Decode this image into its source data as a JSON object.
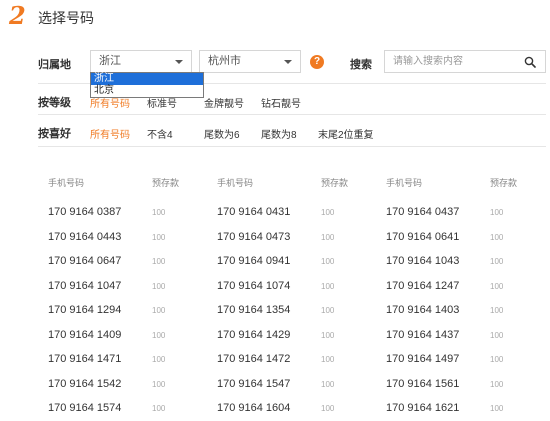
{
  "header": {
    "step": "2",
    "title": "选择号码"
  },
  "location": {
    "label": "归属地",
    "province": "浙江",
    "city": "杭州市",
    "options": [
      "浙江",
      "北京"
    ],
    "help": "?"
  },
  "search": {
    "label": "搜索",
    "placeholder": "请输入搜索内容"
  },
  "grade": {
    "label": "按等级",
    "items": [
      "所有号码",
      "标准号",
      "金牌靓号",
      "钻石靓号"
    ]
  },
  "preference": {
    "label": "按喜好",
    "items": [
      "所有号码",
      "不含4",
      "尾数为6",
      "尾数为8",
      "末尾2位重复"
    ]
  },
  "table": {
    "header_number": "手机号码",
    "header_deposit": "预存款",
    "columns": [
      [
        {
          "number": "170 9164 0387",
          "deposit": "100"
        },
        {
          "number": "170 9164 0443",
          "deposit": "100"
        },
        {
          "number": "170 9164 0647",
          "deposit": "100"
        },
        {
          "number": "170 9164 1047",
          "deposit": "100"
        },
        {
          "number": "170 9164 1294",
          "deposit": "100"
        },
        {
          "number": "170 9164 1409",
          "deposit": "100"
        },
        {
          "number": "170 9164 1471",
          "deposit": "100"
        },
        {
          "number": "170 9164 1542",
          "deposit": "100"
        },
        {
          "number": "170 9164 1574",
          "deposit": "100"
        }
      ],
      [
        {
          "number": "170 9164 0431",
          "deposit": "100"
        },
        {
          "number": "170 9164 0473",
          "deposit": "100"
        },
        {
          "number": "170 9164 0941",
          "deposit": "100"
        },
        {
          "number": "170 9164 1074",
          "deposit": "100"
        },
        {
          "number": "170 9164 1354",
          "deposit": "100"
        },
        {
          "number": "170 9164 1429",
          "deposit": "100"
        },
        {
          "number": "170 9164 1472",
          "deposit": "100"
        },
        {
          "number": "170 9164 1547",
          "deposit": "100"
        },
        {
          "number": "170 9164 1604",
          "deposit": "100"
        }
      ],
      [
        {
          "number": "170 9164 0437",
          "deposit": "100"
        },
        {
          "number": "170 9164 0641",
          "deposit": "100"
        },
        {
          "number": "170 9164 1043",
          "deposit": "100"
        },
        {
          "number": "170 9164 1247",
          "deposit": "100"
        },
        {
          "number": "170 9164 1403",
          "deposit": "100"
        },
        {
          "number": "170 9164 1437",
          "deposit": "100"
        },
        {
          "number": "170 9164 1497",
          "deposit": "100"
        },
        {
          "number": "170 9164 1561",
          "deposit": "100"
        },
        {
          "number": "170 9164 1621",
          "deposit": "100"
        }
      ]
    ]
  },
  "colors": {
    "accent": "#f07a22",
    "selection": "#1e6fd9",
    "divider": "#e6e6e6"
  }
}
